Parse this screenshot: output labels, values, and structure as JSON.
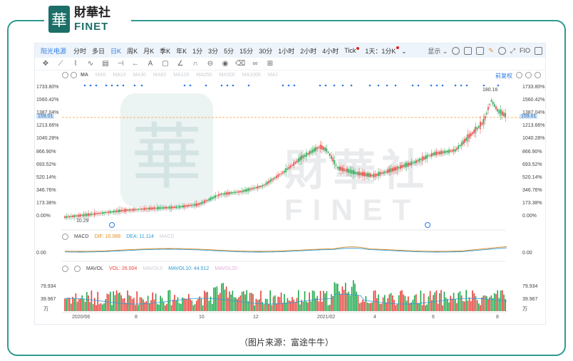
{
  "logo": {
    "mark": "華",
    "cn": "財華社",
    "en": "FINET"
  },
  "watermark": {
    "cn": "財華社",
    "en": "FINET",
    "mark": "華"
  },
  "toolbar": {
    "stock_name": "阳光电源",
    "periods": [
      "分时",
      "多日",
      "日K",
      "周K",
      "月K",
      "季K",
      "年K",
      "1分",
      "3分",
      "5分",
      "15分",
      "30分",
      "1小时",
      "2小时",
      "4小时",
      "Tick",
      "1天：1分K"
    ],
    "selected_period": "日K",
    "display_label": "显示",
    "fio_label": "FIO"
  },
  "ma_legend": [
    "MA",
    "MA5",
    "MA10",
    "MA30",
    "MA60",
    "MA120",
    "MA250",
    "MA500",
    "MA1000",
    "MA1"
  ],
  "adjust_label": "前复权",
  "y_labels": [
    "1733.80%",
    "1560.42%",
    "1387.04%",
    "1213.66%",
    "1040.28%",
    "866.90%",
    "693.52%",
    "520.14%",
    "346.76%",
    "173.38%",
    "0.00%"
  ],
  "current_price": "159.01",
  "high_label": "180.16",
  "low_label": "10.29",
  "macd": {
    "name": "MACD",
    "dif": "DIF: 10.066",
    "dea": "DEA: 11.114",
    "macd": "MACD",
    "zero": "0.00"
  },
  "mavol": {
    "name": "MAVOL",
    "vol": "VOL: 26.004",
    "mavol5": "MAVOL5",
    "mavol10": "MAVOL10: 44.512",
    "mavol20": "MAVOL20",
    "high": "79.934",
    "mid": "39.967",
    "unit": "万"
  },
  "x_labels": [
    "2020/06",
    "8",
    "10",
    "12",
    "2021/02",
    "4",
    "6",
    "8"
  ],
  "caption": "（图片来源：富途牛牛）",
  "colors": {
    "up": "#e8413b",
    "down": "#1fa84b",
    "accent": "#2f7ae5",
    "frame": "#2e9b8f"
  }
}
